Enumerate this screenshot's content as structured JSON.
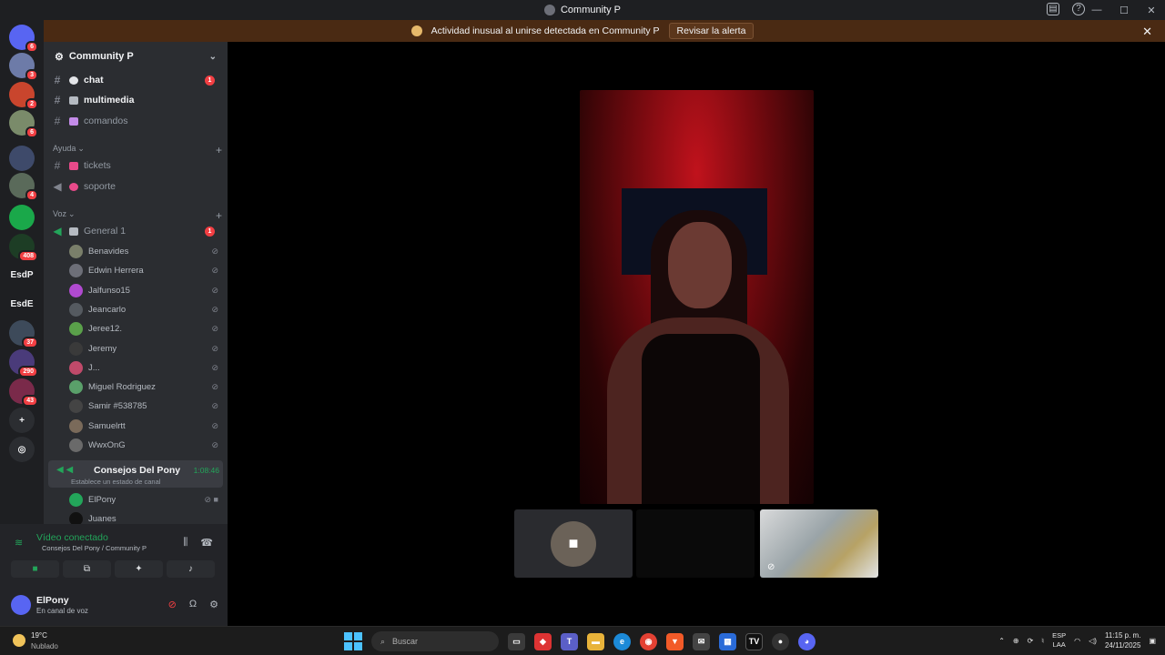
{
  "window": {
    "title": "Community P",
    "controls": [
      "—",
      "☐",
      "✕"
    ]
  },
  "alert": {
    "text": "Actividad inusual al unirse detectada en Community P",
    "button": "Revisar la alerta",
    "close": "✕"
  },
  "guilds": [
    {
      "label": "",
      "badge": "6",
      "color": "#5865f2"
    },
    {
      "label": "",
      "badge": "3",
      "color": "#6d7ba8"
    },
    {
      "label": "",
      "badge": "2",
      "color": "#c9452d"
    },
    {
      "label": "",
      "badge": "6",
      "color": "#7a8b6a"
    },
    {
      "label": "",
      "badge": "",
      "color": "#3e4a6a"
    },
    {
      "label": "",
      "badge": "4",
      "color": "#5a6a5a"
    },
    {
      "label": "",
      "badge": "",
      "color": "#1aa84a"
    },
    {
      "label": "",
      "badge": "408",
      "color": "#1d3d25"
    },
    {
      "label": "EsdP",
      "badge": "",
      "color": "transparent"
    },
    {
      "label": "EsdE",
      "badge": "",
      "color": "transparent"
    },
    {
      "label": "",
      "badge": "37",
      "color": "#3d4a5a"
    },
    {
      "label": "",
      "badge": "290",
      "color": "#4a3b7a"
    },
    {
      "label": "",
      "badge": "43",
      "color": "#7a2a4a"
    },
    {
      "label": "+",
      "badge": "",
      "color": "#2b2d31"
    },
    {
      "label": "◎",
      "badge": "",
      "color": "#2b2d31"
    }
  ],
  "server": {
    "name": "Community P",
    "channels_top": [
      {
        "name": "chat",
        "bold": true,
        "unread": "1",
        "emoji_color": "#e3e5e8"
      },
      {
        "name": "multimedia",
        "bold": true,
        "unread": "",
        "emoji_color": "#b5bac1"
      },
      {
        "name": "comandos",
        "bold": false,
        "unread": "",
        "emoji_color": "#c38be8"
      }
    ],
    "category_ayuda": "Ayuda",
    "channels_ayuda": [
      {
        "name": "tickets",
        "emoji_color": "#e84a8a"
      },
      {
        "name": "soporte",
        "emoji_color": "#e84a8a"
      }
    ],
    "category_voz": "Voz",
    "voice_general": {
      "name": "General 1",
      "unread": "1"
    },
    "members": [
      {
        "name": "Benavides",
        "color": "#7a7f6a"
      },
      {
        "name": "Edwin Herrera",
        "color": "#6d6f78"
      },
      {
        "name": "Jalfunso15",
        "color": "#b04ad0"
      },
      {
        "name": "Jeancarlo",
        "color": "#555a60"
      },
      {
        "name": "Jeree12.",
        "color": "#5aa04a"
      },
      {
        "name": "Jeremy",
        "color": "#3a3a3a"
      },
      {
        "name": "J...",
        "color": "#c04a6a"
      },
      {
        "name": "Miguel Rodriguez",
        "color": "#5aa06a"
      },
      {
        "name": "Samir #538785",
        "color": "#444"
      },
      {
        "name": "Samuelrtt",
        "color": "#7a6a5a"
      },
      {
        "name": "WwxOnG",
        "color": "#6a6a6a"
      }
    ],
    "voice_active": {
      "name": "Consejos Del Pony",
      "time": "1:08:46",
      "status": "Establece un estado de canal"
    },
    "voice_members": [
      {
        "name": "ElPony",
        "color": "#5865f2"
      },
      {
        "name": "Juanes",
        "color": "#111"
      }
    ]
  },
  "voice_panel": {
    "status": "Vídeo conectado",
    "sub": "Consejos Del Pony / Community P"
  },
  "user": {
    "name": "ElPony",
    "status": "En canal de voz"
  },
  "taskbar": {
    "temp": "19°C",
    "weather": "Nublado",
    "search_placeholder": "Buscar",
    "lang_top": "ESP",
    "lang_bottom": "LAA",
    "time": "11:15 p. m.",
    "date": "24/11/2025"
  }
}
